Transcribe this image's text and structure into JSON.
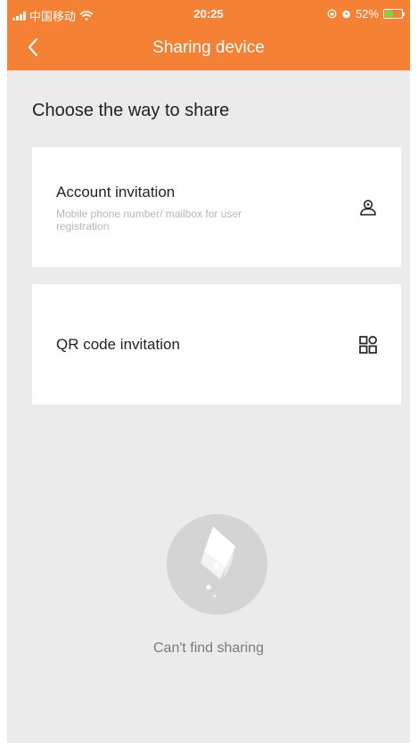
{
  "status_bar": {
    "carrier": "中国移动",
    "time": "20:25",
    "battery": "52%",
    "battery_level": 0.52
  },
  "nav": {
    "title": "Sharing device",
    "back_icon": "chevron-left-icon"
  },
  "heading": "Choose the way to share",
  "options": [
    {
      "title": "Account invitation",
      "subtitle": "Mobile phone number/ mailbox for user registration",
      "icon": "user-icon"
    },
    {
      "title": "QR code invitation",
      "icon": "qr-code-icon"
    }
  ],
  "empty_state": {
    "text": "Can't find sharing",
    "icon": "empty-box-icon"
  },
  "colors": {
    "accent": "#f58134",
    "background": "#ebebeb",
    "card": "#ffffff"
  }
}
